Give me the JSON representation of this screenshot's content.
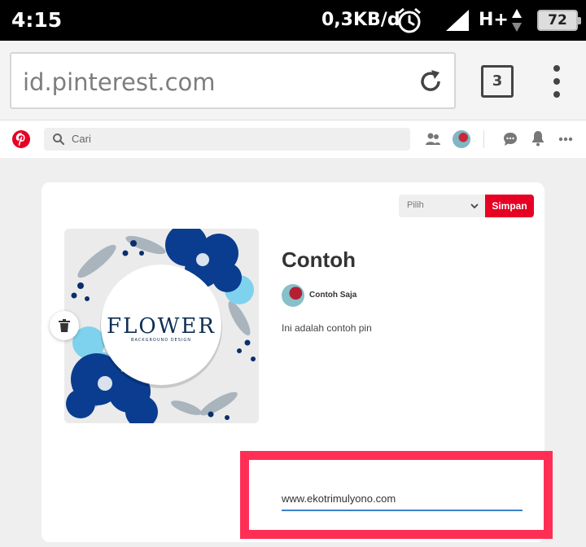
{
  "status_bar": {
    "time": "4:15",
    "speed": "0,3KB/d",
    "network": "H+",
    "battery": "72"
  },
  "browser": {
    "url": "id.pinterest.com",
    "tab_count": "3"
  },
  "pinterest_header": {
    "search_placeholder": "Cari",
    "icons": [
      "pinterest-logo",
      "search-icon",
      "people-icon",
      "avatar",
      "chat-icon",
      "bell-icon",
      "more-icon"
    ]
  },
  "pin": {
    "board_select": "Pilih",
    "save_label": "Simpan",
    "title": "Contoh",
    "author": "Contoh Saja",
    "description": "Ini adalah contoh pin",
    "website": "www.ekotrimulyono.com",
    "image_text": "FLOWER",
    "image_subtext": "BACKGROUND DESIGN"
  },
  "colors": {
    "pinterest_red": "#e60023",
    "highlight": "#ff2e55",
    "input_underline": "#3b82c8"
  }
}
